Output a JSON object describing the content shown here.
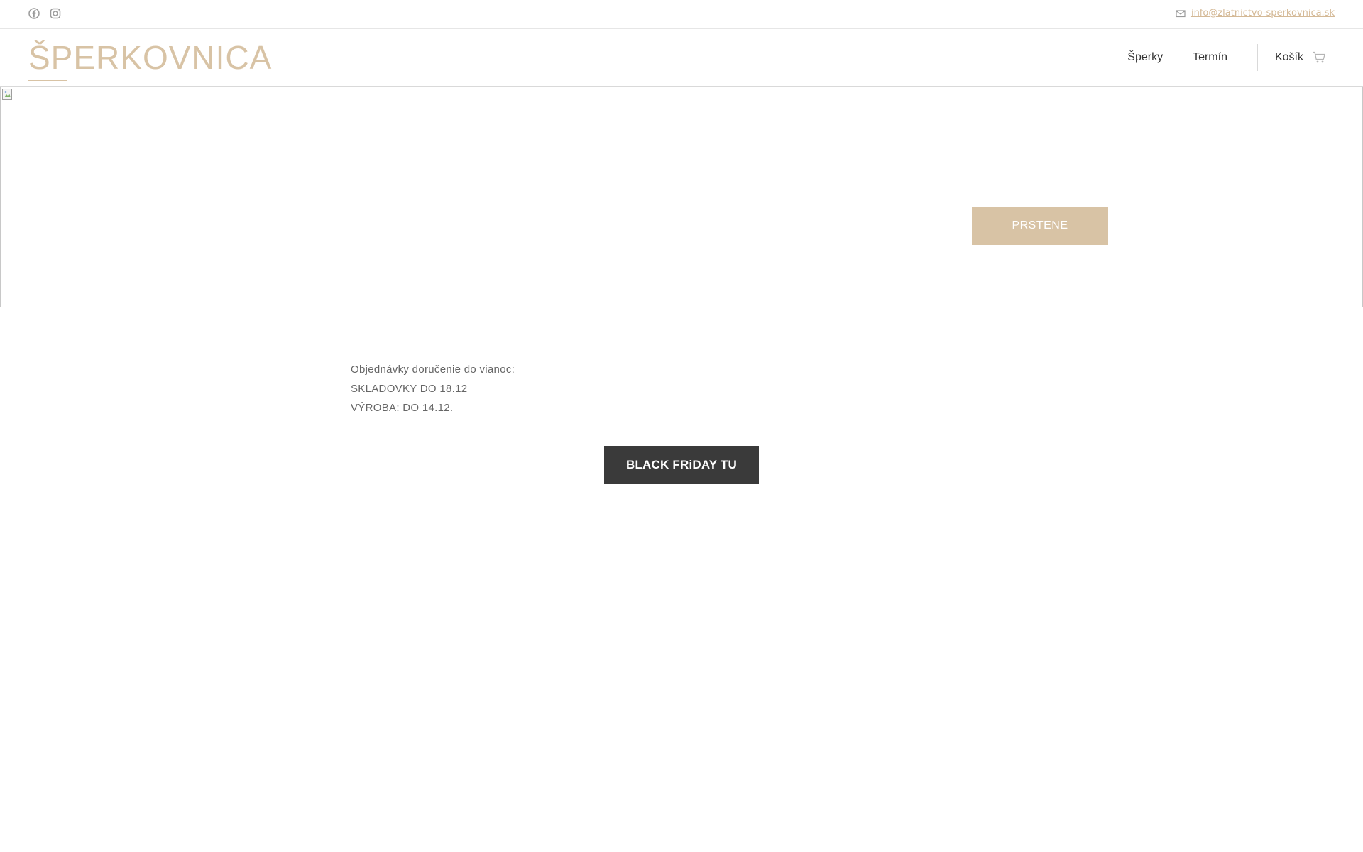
{
  "topbar": {
    "social": [
      {
        "icon": "facebook-icon"
      },
      {
        "icon": "instagram-icon"
      }
    ],
    "email": "info@zlatnictvo-sperkovnica.sk"
  },
  "header": {
    "logo": "ŠPERKOVNICA",
    "nav": [
      {
        "label": "Šperky"
      },
      {
        "label": "Termín"
      }
    ],
    "cart_label": "Košík"
  },
  "hero": {
    "button_label": "PRSTENE"
  },
  "notice": {
    "lines": [
      "Objednávky doručenie do vianoc:",
      "SKLADOVKY DO 18.12",
      "VÝROBA: DO 14.12."
    ]
  },
  "cta": {
    "label": "BLACK FRiDAY TU"
  },
  "colors": {
    "accent": "#d8c3a5",
    "dark_button": "#3a3a3a"
  }
}
